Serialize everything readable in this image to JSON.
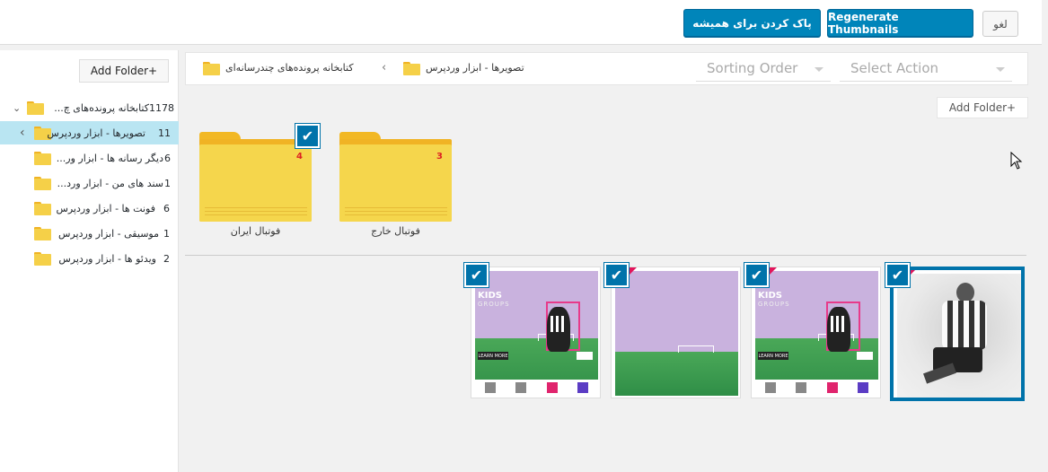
{
  "header": {
    "cancel_label": "لغو",
    "regenerate_label": "Regenerate Thumbnails",
    "delete_forever_label": "پاک کردن برای همیشه"
  },
  "sidebar": {
    "add_folder_label": "Add Folder+",
    "root": {
      "label": "کتابخانه پرونده‌های چ...",
      "count": "1178"
    },
    "items": [
      {
        "label": "تصویرها - ابزار وردپرس",
        "count": "11",
        "active": true
      },
      {
        "label": "دیگر رسانه ها - ابزار ور...",
        "count": "6"
      },
      {
        "label": "سند های من - ابزار ورد...",
        "count": "1"
      },
      {
        "label": "فونت ها - ابزار وردپرس",
        "count": "6"
      },
      {
        "label": "موسیقی - ابزار وردپرس",
        "count": "1"
      },
      {
        "label": "ویدئو ها - ابزار وردپرس",
        "count": "2"
      }
    ]
  },
  "toolbar": {
    "breadcrumb": [
      "کتابخانه پرونده‌های چندرسانه‌ای",
      "تصویرها - ابزار وردپرس"
    ],
    "separator": "‹",
    "sorting_placeholder": "Sorting Order",
    "action_placeholder": "Select Action",
    "add_folder_label": "Add Folder+"
  },
  "folders": [
    {
      "name": "فوتبال ایران",
      "count": "4",
      "checked": true
    },
    {
      "name": "فوتبال خارج",
      "count": "3",
      "checked": false
    }
  ],
  "thumbnails": {
    "items": [
      {
        "kind": "kids-groups",
        "heading": "KIDS",
        "subheading": "GROUPS",
        "button": "LEARN MORE",
        "checked": true
      },
      {
        "kind": "field",
        "checked": true
      },
      {
        "kind": "kids-groups",
        "heading": "KIDS",
        "subheading": "GROUPS",
        "button": "LEARN MORE",
        "checked": true
      },
      {
        "kind": "bw-player",
        "checked": true,
        "selected": true
      }
    ]
  },
  "icons": {
    "checkmark": "✔",
    "caret_down": "⌄",
    "caret_left": "‹"
  },
  "colors": {
    "primary": "#0085ba",
    "active_row": "#b9e5f2",
    "folder": "#f5d048",
    "accent_pink": "#e2145b"
  }
}
